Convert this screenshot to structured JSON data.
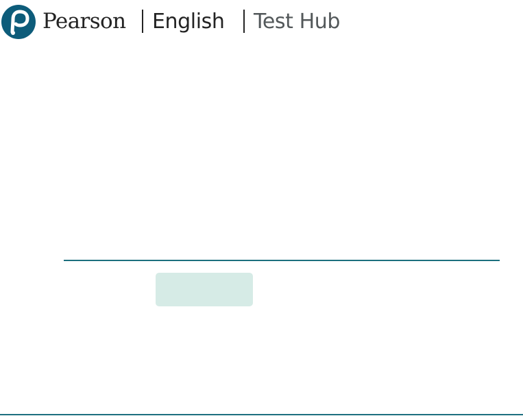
{
  "header": {
    "brand": "Pearson",
    "product": "English",
    "section": "Test Hub",
    "logo_letter": "P"
  },
  "main": {
    "action_button_label": ""
  },
  "colors": {
    "logo_blue": "#0d5c7a",
    "accent_teal": "#1c6f7e",
    "button_fill": "#d6ebe6",
    "text_dark": "#232323",
    "text_gray": "#53585a"
  },
  "icons": {
    "logo": "pearson-p-logo-icon"
  }
}
